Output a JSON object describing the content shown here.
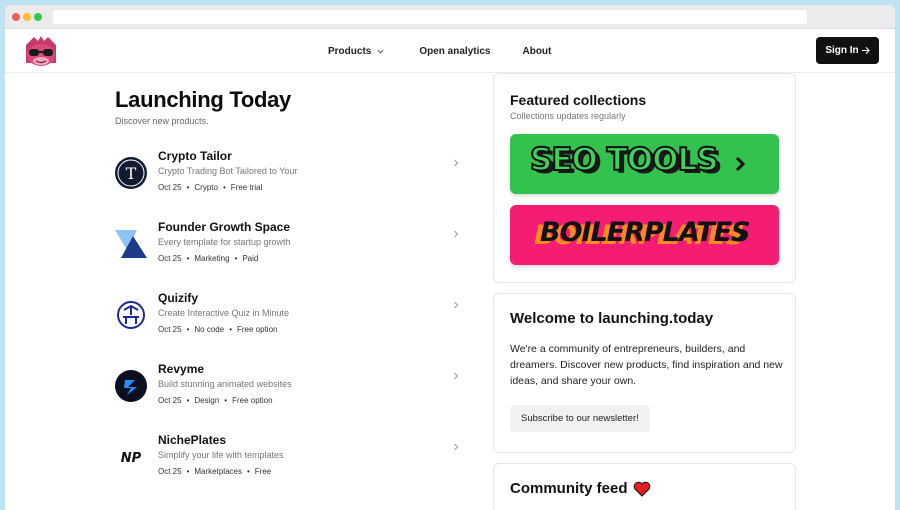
{
  "nav": {
    "products_label": "Products",
    "analytics_label": "Open analytics",
    "about_label": "About",
    "signin_label": "Sign In"
  },
  "main": {
    "title": "Launching Today",
    "subtitle": "Discover new products.",
    "products": [
      {
        "name": "Crypto Tailor",
        "description": "Crypto Trading Bot Tailored to Your",
        "date": "Oct 25",
        "category": "Crypto",
        "pricing": "Free trial",
        "icon": "crypto-tailor-logo-icon"
      },
      {
        "name": "Founder Growth Space",
        "description": "Every template for startup growth",
        "date": "Oct 25",
        "category": "Marketing",
        "pricing": "Paid",
        "icon": "founder-growth-logo-icon"
      },
      {
        "name": "Quizify",
        "description": "Create Interactive Quiz in Minute",
        "date": "Oct 25",
        "category": "No code",
        "pricing": "Free option",
        "icon": "quizify-logo-icon"
      },
      {
        "name": "Revyme",
        "description": "Build stunning animated websites",
        "date": "Oct 25",
        "category": "Design",
        "pricing": "Free option",
        "icon": "revyme-logo-icon"
      },
      {
        "name": "NichePlates",
        "description": "Simplify your life with templates",
        "date": "Oct 25",
        "category": "Marketplaces",
        "pricing": "Free",
        "icon": "nicheplates-logo-icon"
      }
    ],
    "crypto_logo_letter": "T",
    "nicheplates_logo_text": "NP"
  },
  "featured": {
    "title": "Featured collections",
    "subtitle": "Collections updates regularly",
    "collections": [
      {
        "label": "SEO TOOLS",
        "color": "#34c24f"
      },
      {
        "label": "BOILERPLATES",
        "color": "#f51d73"
      }
    ]
  },
  "welcome": {
    "title": "Welcome to launching.today",
    "body": "We're a community of entrepreneurs, builders, and dreamers. Discover new products, find inspiration and new ideas, and share your own.",
    "button_label": "Subscribe to our newsletter!"
  },
  "feed": {
    "title": "Community feed",
    "emoji": "heart-icon"
  },
  "colors": {
    "accent_dark": "#111111",
    "page_bg": "#bfe3f2"
  }
}
